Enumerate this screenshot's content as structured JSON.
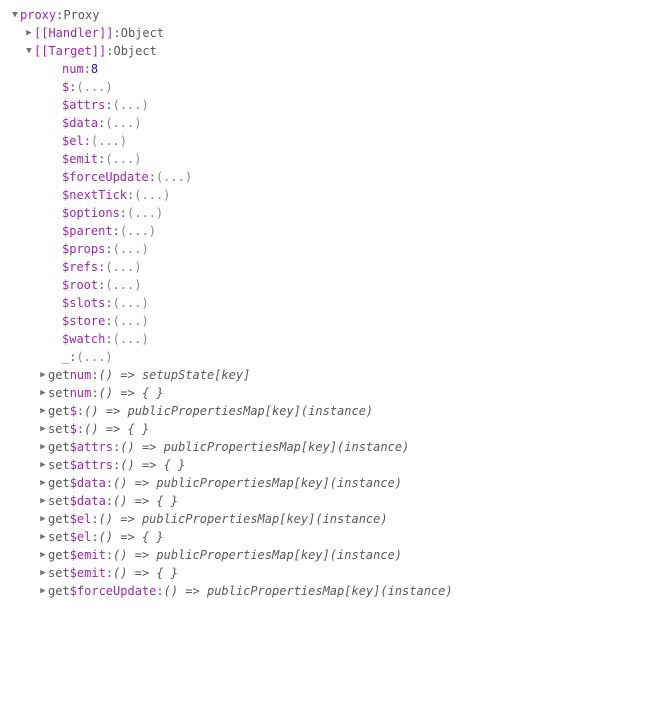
{
  "colon": ": ",
  "ellipsis": "(...)",
  "root": {
    "key": "proxy",
    "type": "Proxy"
  },
  "handler": {
    "key": "[[Handler]]",
    "type": "Object"
  },
  "target": {
    "key": "[[Target]]",
    "type": "Object"
  },
  "num": {
    "key": "num",
    "value": "8"
  },
  "props": [
    "$",
    "$attrs",
    "$data",
    "$el",
    "$emit",
    "$forceUpdate",
    "$nextTick",
    "$options",
    "$parent",
    "$props",
    "$refs",
    "$root",
    "$slots",
    "$store",
    "$watch",
    "_"
  ],
  "accessors": [
    {
      "kind": "get",
      "name": "num",
      "body": "() => setupState[key]"
    },
    {
      "kind": "set",
      "name": "num",
      "body": "() => { }"
    },
    {
      "kind": "get",
      "name": "$",
      "body": "() => publicPropertiesMap[key](instance)"
    },
    {
      "kind": "set",
      "name": "$",
      "body": "() => { }"
    },
    {
      "kind": "get",
      "name": "$attrs",
      "body": "() => publicPropertiesMap[key](instance)"
    },
    {
      "kind": "set",
      "name": "$attrs",
      "body": "() => { }"
    },
    {
      "kind": "get",
      "name": "$data",
      "body": "() => publicPropertiesMap[key](instance)"
    },
    {
      "kind": "set",
      "name": "$data",
      "body": "() => { }"
    },
    {
      "kind": "get",
      "name": "$el",
      "body": "() => publicPropertiesMap[key](instance)"
    },
    {
      "kind": "set",
      "name": "$el",
      "body": "() => { }"
    },
    {
      "kind": "get",
      "name": "$emit",
      "body": "() => publicPropertiesMap[key](instance)"
    },
    {
      "kind": "set",
      "name": "$emit",
      "body": "() => { }"
    },
    {
      "kind": "get",
      "name": "$forceUpdate",
      "body": "() => publicPropertiesMap[key](instance)"
    }
  ]
}
